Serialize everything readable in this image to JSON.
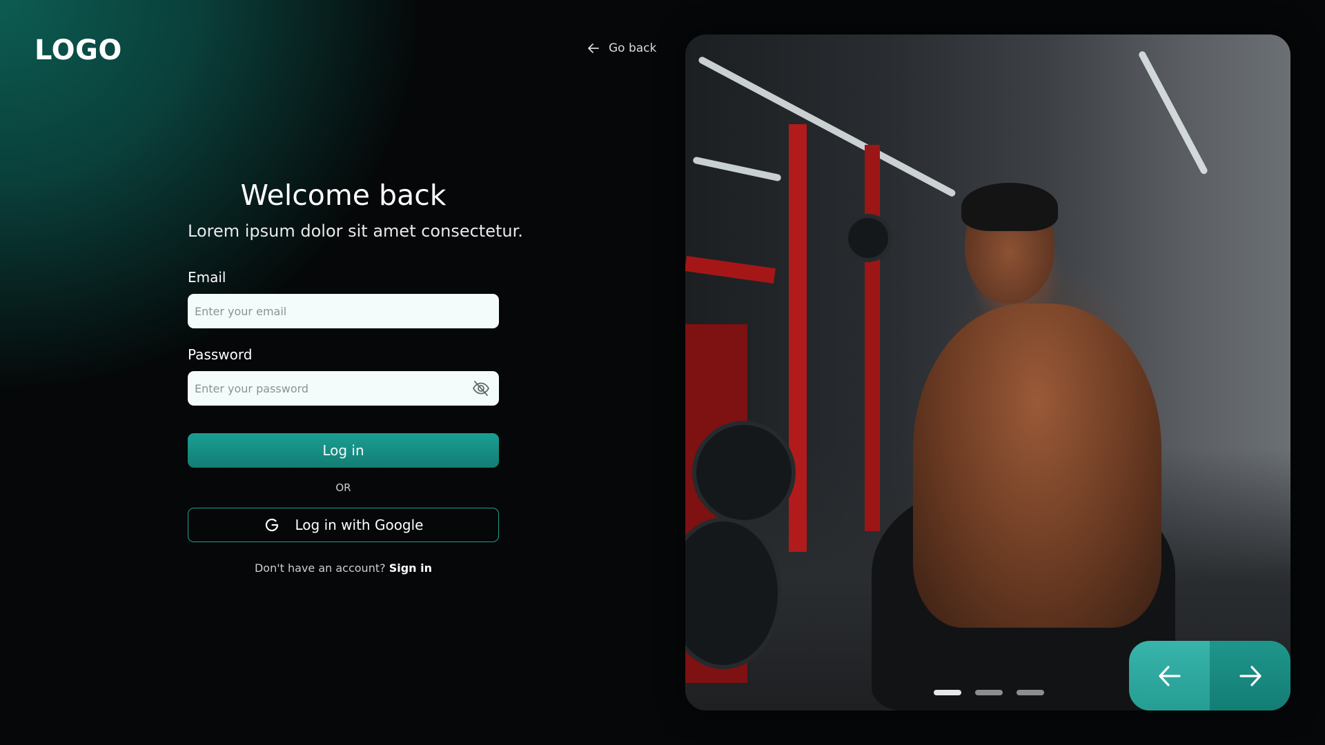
{
  "brand": {
    "logo_text": "LOGO"
  },
  "header": {
    "go_back_label": "Go back"
  },
  "form": {
    "title": "Welcome back",
    "subtitle": "Lorem ipsum dolor sit amet consectetur.",
    "email": {
      "label": "Email",
      "placeholder": "Enter your email",
      "value": ""
    },
    "password": {
      "label": "Password",
      "placeholder": "Enter your password",
      "value": ""
    },
    "login_button_label": "Log in",
    "divider_text": "OR",
    "google_button_label": "Log in with Google",
    "signup_prompt": "Don't have an account?",
    "signup_link": "Sign in"
  },
  "carousel": {
    "slide_count": 3,
    "active_index": 0
  },
  "colors": {
    "accent": "#1b9e93",
    "accent_dark": "#137d74",
    "background": "#050708"
  },
  "icons": {
    "back": "arrow-left-icon",
    "password_toggle": "eye-off-icon",
    "google": "google-icon",
    "prev": "arrow-left-icon",
    "next": "arrow-right-icon"
  }
}
